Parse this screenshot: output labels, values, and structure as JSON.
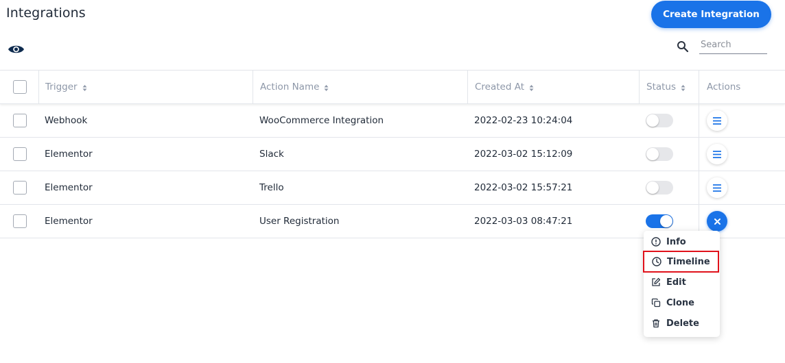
{
  "page": {
    "title": "Integrations"
  },
  "toolbar": {
    "create_label": "Create Integration",
    "search_placeholder": "Search"
  },
  "table": {
    "columns": {
      "trigger": "Trigger",
      "action_name": "Action Name",
      "created_at": "Created At",
      "status": "Status",
      "actions": "Actions"
    },
    "rows": [
      {
        "trigger": "Webhook",
        "action_name": "WooCommerce Integration",
        "created_at": "2022-02-23 10:24:04",
        "status_on": false
      },
      {
        "trigger": "Elementor",
        "action_name": "Slack",
        "created_at": "2022-03-02 15:12:09",
        "status_on": false
      },
      {
        "trigger": "Elementor",
        "action_name": "Trello",
        "created_at": "2022-03-02 15:57:21",
        "status_on": false
      },
      {
        "trigger": "Elementor",
        "action_name": "User Registration",
        "created_at": "2022-03-03 08:47:21",
        "status_on": true
      }
    ]
  },
  "menu": {
    "items": [
      {
        "label": "Info",
        "icon": "info-icon"
      },
      {
        "label": "Timeline",
        "icon": "clock-icon",
        "highlighted": true
      },
      {
        "label": "Edit",
        "icon": "edit-icon"
      },
      {
        "label": "Clone",
        "icon": "clone-icon"
      },
      {
        "label": "Delete",
        "icon": "trash-icon"
      }
    ]
  },
  "colors": {
    "accent": "#1a73e8",
    "highlight": "#e0111a",
    "text": "#1f2937",
    "muted": "#8d97a8"
  }
}
